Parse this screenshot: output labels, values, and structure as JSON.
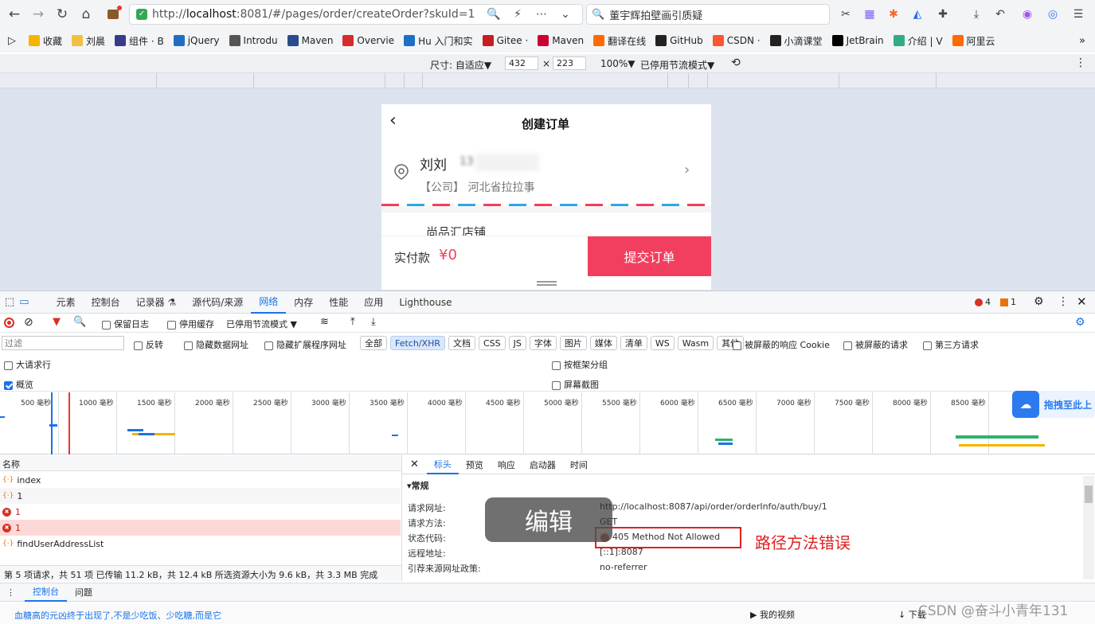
{
  "browser": {
    "url_prefix": "http://",
    "url_host": "localhost",
    "url_rest": ":8081/#/pages/order/createOrder?skuId=1",
    "search_text": "董宇辉拍壁画引质疑",
    "toolbar_icons": [
      "back-icon",
      "forward-icon",
      "reload-icon",
      "home-icon",
      "extension-icon",
      "zoom-icon",
      "flash-icon",
      "more-icon",
      "chevron-down-icon"
    ]
  },
  "bookmarks": [
    {
      "label": "收藏",
      "icon": "star-icon",
      "color": "#f4b400"
    },
    {
      "label": "刘晨",
      "icon": "folder-icon",
      "color": "#f0c040"
    },
    {
      "label": "组件 · B",
      "icon": "b-icon",
      "color": "#3a3a8c"
    },
    {
      "label": "jQuery",
      "icon": "jquery-icon",
      "color": "#1e6fc4"
    },
    {
      "label": "Introdu",
      "icon": "book-icon",
      "color": "#555"
    },
    {
      "label": "Maven",
      "icon": "maven-icon",
      "color": "#2a4b8c"
    },
    {
      "label": "Overvie",
      "icon": "overview-icon",
      "color": "#d62c2c"
    },
    {
      "label": "Hu 入门和实",
      "icon": "hu-icon",
      "color": "#1e6fc4"
    },
    {
      "label": "Gitee ·",
      "icon": "gitee-icon",
      "color": "#c71d23"
    },
    {
      "label": "Maven",
      "icon": "maven-feather-icon",
      "color": "#c03"
    },
    {
      "label": "翻译在线",
      "icon": "translate-icon",
      "color": "#ff6a00"
    },
    {
      "label": "GitHub",
      "icon": "github-icon",
      "color": "#222"
    },
    {
      "label": "CSDN ·",
      "icon": "csdn-icon",
      "color": "#fc5531"
    },
    {
      "label": "小滴课堂",
      "icon": "xd-icon",
      "color": "#222"
    },
    {
      "label": "JetBrain",
      "icon": "jetbrains-icon",
      "color": "#000"
    },
    {
      "label": "介绍 | V",
      "icon": "vue-icon",
      "color": "#3a8"
    },
    {
      "label": "阿里云",
      "icon": "aliyun-icon",
      "color": "#ff6a00"
    }
  ],
  "device_toolbar": {
    "size_label": "尺寸: 自适应▼",
    "width": "432",
    "height": "223",
    "times": "×",
    "zoom": "100%▼",
    "throttle": "已停用节流模式▼"
  },
  "phone": {
    "title": "创建订单",
    "name": "刘刘",
    "phone_masked": "13",
    "address": "【公司】 河北省拉拉事",
    "shop": "尚品汇店铺",
    "pay_label": "实付款",
    "pay_amount": "¥0",
    "submit": "提交订单",
    "accent": "#f23f5f"
  },
  "devtools": {
    "tabs": [
      "元素",
      "控制台",
      "记录器 ⚗",
      "源代码/来源",
      "网络",
      "内存",
      "性能",
      "应用",
      "Lighthouse"
    ],
    "active_tab": "网络",
    "error_count": "4",
    "warn_count": "1",
    "net_toolbar": {
      "preserve_log": "保留日志",
      "disable_cache": "停用缓存",
      "throttle": "已停用节流模式"
    },
    "filter": {
      "placeholder": "过滤",
      "invert": "反转",
      "hide_data_urls": "隐藏数据网址",
      "hide_ext_urls": "隐藏扩展程序网址",
      "types": [
        "全部",
        "Fetch/XHR",
        "文档",
        "CSS",
        "JS",
        "字体",
        "图片",
        "媒体",
        "清单",
        "WS",
        "Wasm",
        "其他"
      ],
      "active_type": "Fetch/XHR",
      "blocked_cookies": "被屏蔽的响应 Cookie",
      "blocked_requests": "被屏蔽的请求",
      "third_party": "第三方请求"
    },
    "options": {
      "big_rows": "大请求行",
      "overview": "概览",
      "group_by_frame": "按框架分组",
      "screenshots": "屏幕截图"
    },
    "timeline_ticks": [
      "500 毫秒",
      "1000 毫秒",
      "1500 毫秒",
      "2000 毫秒",
      "2500 毫秒",
      "3000 毫秒",
      "3500 毫秒",
      "4000 毫秒",
      "4500 毫秒",
      "5000 毫秒",
      "5500 毫秒",
      "6000 毫秒",
      "6500 毫秒",
      "7000 毫秒",
      "7500 毫秒",
      "8000 毫秒",
      "8500 毫秒"
    ],
    "drag_hint": "拖拽至此上",
    "name_header": "名称",
    "requests": [
      {
        "name": "index",
        "error": false
      },
      {
        "name": "1",
        "error": false
      },
      {
        "name": "1",
        "error": true
      },
      {
        "name": "1",
        "error": true
      },
      {
        "name": "findUserAddressList",
        "error": false
      }
    ],
    "status_bar": "第 5 项请求，共 51 项  已传输 11.2 kB，共 12.4 kB  所选资源大小为 9.6 kB，共 3.3 MB  完成",
    "detail_tabs": [
      "标头",
      "预览",
      "响应",
      "启动器",
      "时间"
    ],
    "general_title": "▾常规",
    "headers": [
      {
        "label": "请求网址:",
        "value": "http://localhost:8087/api/order/orderInfo/auth/buy/1"
      },
      {
        "label": "请求方法:",
        "value": "GET"
      },
      {
        "label": "状态代码:",
        "value": "405 Method Not Allowed"
      },
      {
        "label": "远程地址:",
        "value": "[::1]:8087"
      },
      {
        "label": "引荐来源网址政策:",
        "value": "no-referrer"
      }
    ],
    "drawer_tabs": [
      "控制台",
      "问题"
    ],
    "drawer_active": "控制台",
    "console_text": "血糖高的元凶终于出现了,不是少吃饭、少吃糖,而是它",
    "bottom_items": [
      "我的视频",
      "下载"
    ]
  },
  "overlay": {
    "edit_label": "编辑",
    "annotation": "路径方法错误",
    "annotation_color": "#e02020",
    "watermark": "CSDN @奋斗小青年131"
  }
}
